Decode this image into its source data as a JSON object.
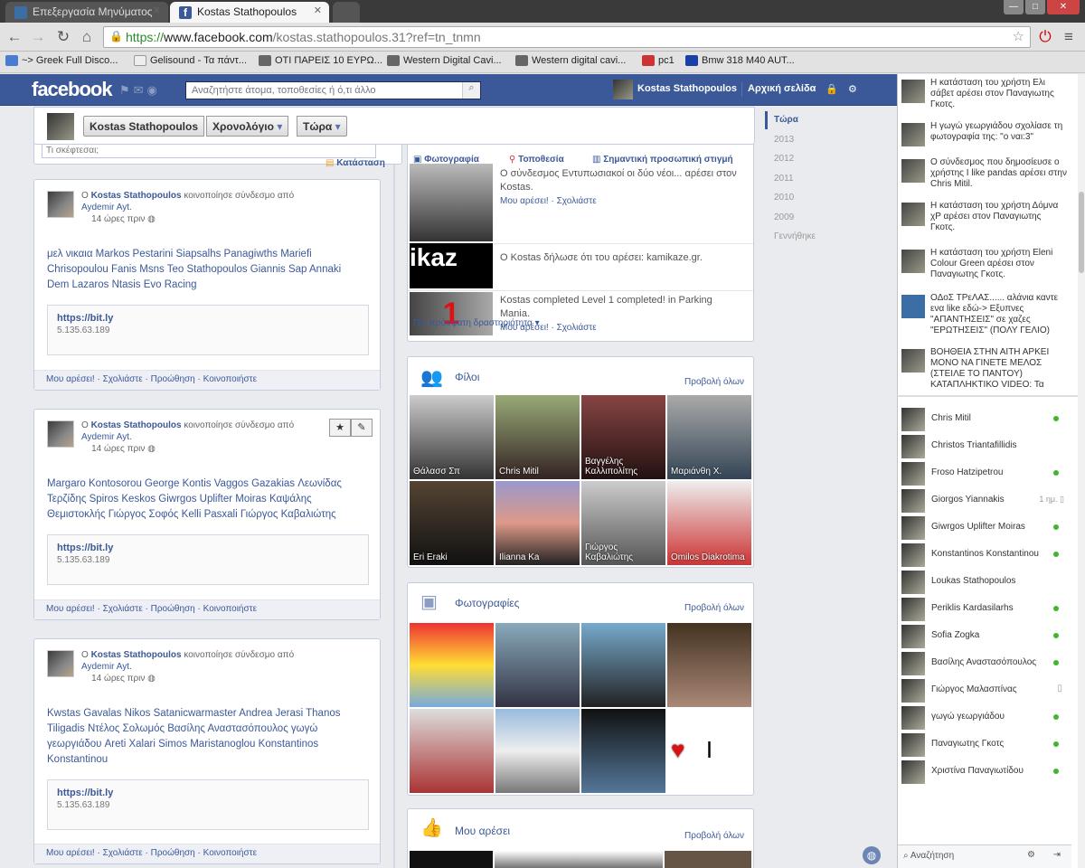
{
  "browser": {
    "tabs": [
      {
        "label": "Επεξεργασία Μηνύματος"
      },
      {
        "label": "Kostas Stathopoulos"
      }
    ],
    "url_scheme": "https://",
    "url_domain": "www.facebook.com",
    "url_path": "/kostas.stathopoulos.31?ref=tn_tnmn",
    "bookmarks": [
      "~> Greek Full Disco...",
      "Gelisound - Τα πάντ...",
      "ΟΤΙ ΠΑΡΕΙΣ 10 ΕΥΡΩ...",
      "Western Digital Cavi...",
      "Western digital cavi...",
      "pc1",
      "Bmw 318 M40 AUT..."
    ]
  },
  "fb": {
    "logo": "facebook",
    "search_placeholder": "Αναζητήστε άτομα, τοποθεσίες ή ό,τι άλλο",
    "user": "Kostas Stathopoulos",
    "home": "Αρχική σελίδα"
  },
  "timeline_head": {
    "name": "Kostas Stathopoulos",
    "timeline": "Χρονολόγιο",
    "now": "Τώρα"
  },
  "composer": {
    "placeholder": "Τι σκέφτεσαι;",
    "status": "Κατάσταση"
  },
  "posts": [
    {
      "author": "Kostas Stathopoulos",
      "shared": "κοινοποίησε σύνδεσμο από",
      "source": "Aydemir Ayt.",
      "time": "14 ώρες πριν",
      "names": "μελ νικαια Markos Pestarini Siapsalhs Panagiwths Mariefi Chrisopoulou Fanis Msns Teo Stathopoulos Giannis Sap Annaki Dem Lazaros Ntasis Evo Racing",
      "link": "https://bit.ly",
      "ip": "5.135.63.189"
    },
    {
      "author": "Kostas Stathopoulos",
      "shared": "κοινοποίησε σύνδεσμο από",
      "source": "Aydemir Ayt.",
      "time": "14 ώρες πριν",
      "names": "Margaro Kontosorou George Kontis Vaggos Gazakias Λεωνίδας Τερζίδης Spiros Keskos Giwrgos Uplifter Moiras Καψάλης Θεμιστοκλής Γιώργος Σοφός Kelli Pasxali Γιώργος Καβαλιώτης",
      "link": "https://bit.ly",
      "ip": "5.135.63.189"
    },
    {
      "author": "Kostas Stathopoulos",
      "shared": "κοινοποίησε σύνδεσμο από",
      "source": "Aydemir Ayt.",
      "time": "14 ώρες πριν",
      "names": "Kwstas Gavalas Nikos Satanicwarmaster Andrea Jerasi Thanos Tiligadis Ντέλος Σολωμός Βασίλης Αναστασόπουλος γωγώ γεωργιάδου Areti Xalari Simos Maristanoglou Konstantinos Konstantinou",
      "link": "https://bit.ly",
      "ip": "5.135.63.189"
    }
  ],
  "post_actions": [
    "Μου αρέσει!",
    "Σχολιάστε",
    "Προώθηση",
    "Κοινοποιήστε"
  ],
  "activity": {
    "tabs": [
      "Φωτογραφία",
      "Τοποθεσία",
      "Σημαντική προσωπική στιγμή"
    ],
    "items": [
      {
        "text": "Ο σύνδεσμος Εντυπωσιακοί οι δύο νέοι... αρέσει στον Kostas.",
        "actions": "Μου αρέσει! · Σχολιάστε"
      },
      {
        "text": "Ο Kostas δήλωσε ότι του αρέσει: kamikaze.gr.",
        "actions": ""
      },
      {
        "text": "Kostas completed Level 1 completed! in Parking Mania.",
        "actions": "Μου αρέσει! · Σχολιάστε"
      }
    ],
    "more": "Πιο πρόσφατη δραστηριότητα"
  },
  "friends": {
    "title": "Φίλοι",
    "view_all": "Προβολή όλων",
    "list": [
      "Θάλασσ Σπ",
      "Chris Mitil",
      "Βαγγέλης Καλλιπολίτης",
      "Μαριάνθη Χ.",
      "Eri Eraki",
      "Ilianna Ka",
      "Γιώργος Καβαλιώτης",
      "Omilos Diakrotima"
    ]
  },
  "photos": {
    "title": "Φωτογραφίες",
    "view_all": "Προβολή όλων"
  },
  "likes": {
    "title": "Μου αρέσει",
    "view_all": "Προβολή όλων"
  },
  "years": [
    "Τώρα",
    "2013",
    "2012",
    "2011",
    "2010",
    "2009",
    "Γεννήθηκε"
  ],
  "ticker": [
    "Η κατάσταση του χρήστη Ελι σάβετ αρέσει στον Παναγιωτης Γκοτς.",
    "Η γωγώ γεωργιάδου σχολίασε τη φωτογραφία της: \"ο ναι:3\"",
    "Ο σύνδεσμος που δημοσίευσε ο χρήστης I like pandas αρέσει στην Chris Mitil.",
    "Η κατάσταση του χρήστη Δόμνα χP αρέσει στον Παναγιωτης Γκοτς.",
    "Η κατάσταση του χρήστη Eleni Colour Green αρέσει στον Παναγιωτης Γκοτς.",
    "ΟΔοΣ ΤΡεΛΑΣ...... αλάνια καντε ενα like εδώ-> Εξυπνες \"ΑΠΑΝΤΗΣΕΙΣ\" σε χαζες \"ΕΡΩΤΗΣΕΙΣ\" (ΠΟΛΥ ΓΕΛΙΟ)",
    "ΒΟΗΘΕΙΑ ΣΤΗΝ ΑΙΤΗ ΑΡΚΕΙ ΜΟΝΟ ΝΑ ΓΙΝΕΤΕ ΜΕΛΟΣ (ΣΤΕΙΛΕ ΤΟ ΠΑΝΤΟΥ) ΚΑΤΑΠΛΗΚΤΙΚΟ VIDEO: Τα"
  ],
  "chat": [
    {
      "name": "Chris Mitil",
      "status": "online"
    },
    {
      "name": "Christos Triantafillidis",
      "status": ""
    },
    {
      "name": "Froso Hatzipetrou",
      "status": "online"
    },
    {
      "name": "Giorgos Yiannakis",
      "status": "1 ημ."
    },
    {
      "name": "Giwrgos Uplifter Moiras",
      "status": "online"
    },
    {
      "name": "Konstantinos Konstantinou",
      "status": "online"
    },
    {
      "name": "Loukas Stathopoulos",
      "status": ""
    },
    {
      "name": "Periklis Kardasilarhs",
      "status": "online"
    },
    {
      "name": "Sofia Zogka",
      "status": "online"
    },
    {
      "name": "Βασίλης Αναστασόπουλος",
      "status": "online"
    },
    {
      "name": "Γιώργος Μαλασπίνας",
      "status": "mobile"
    },
    {
      "name": "γωγώ γεωργιάδου",
      "status": "online"
    },
    {
      "name": "Παναγιωτης Γκοτς",
      "status": "online"
    },
    {
      "name": "Χριστίνα Παναγιωτίδου",
      "status": "online"
    }
  ],
  "chat_search": "Αναζήτηση",
  "colors": {
    "fb_blue": "#3b5998",
    "online": "#42b72a"
  }
}
